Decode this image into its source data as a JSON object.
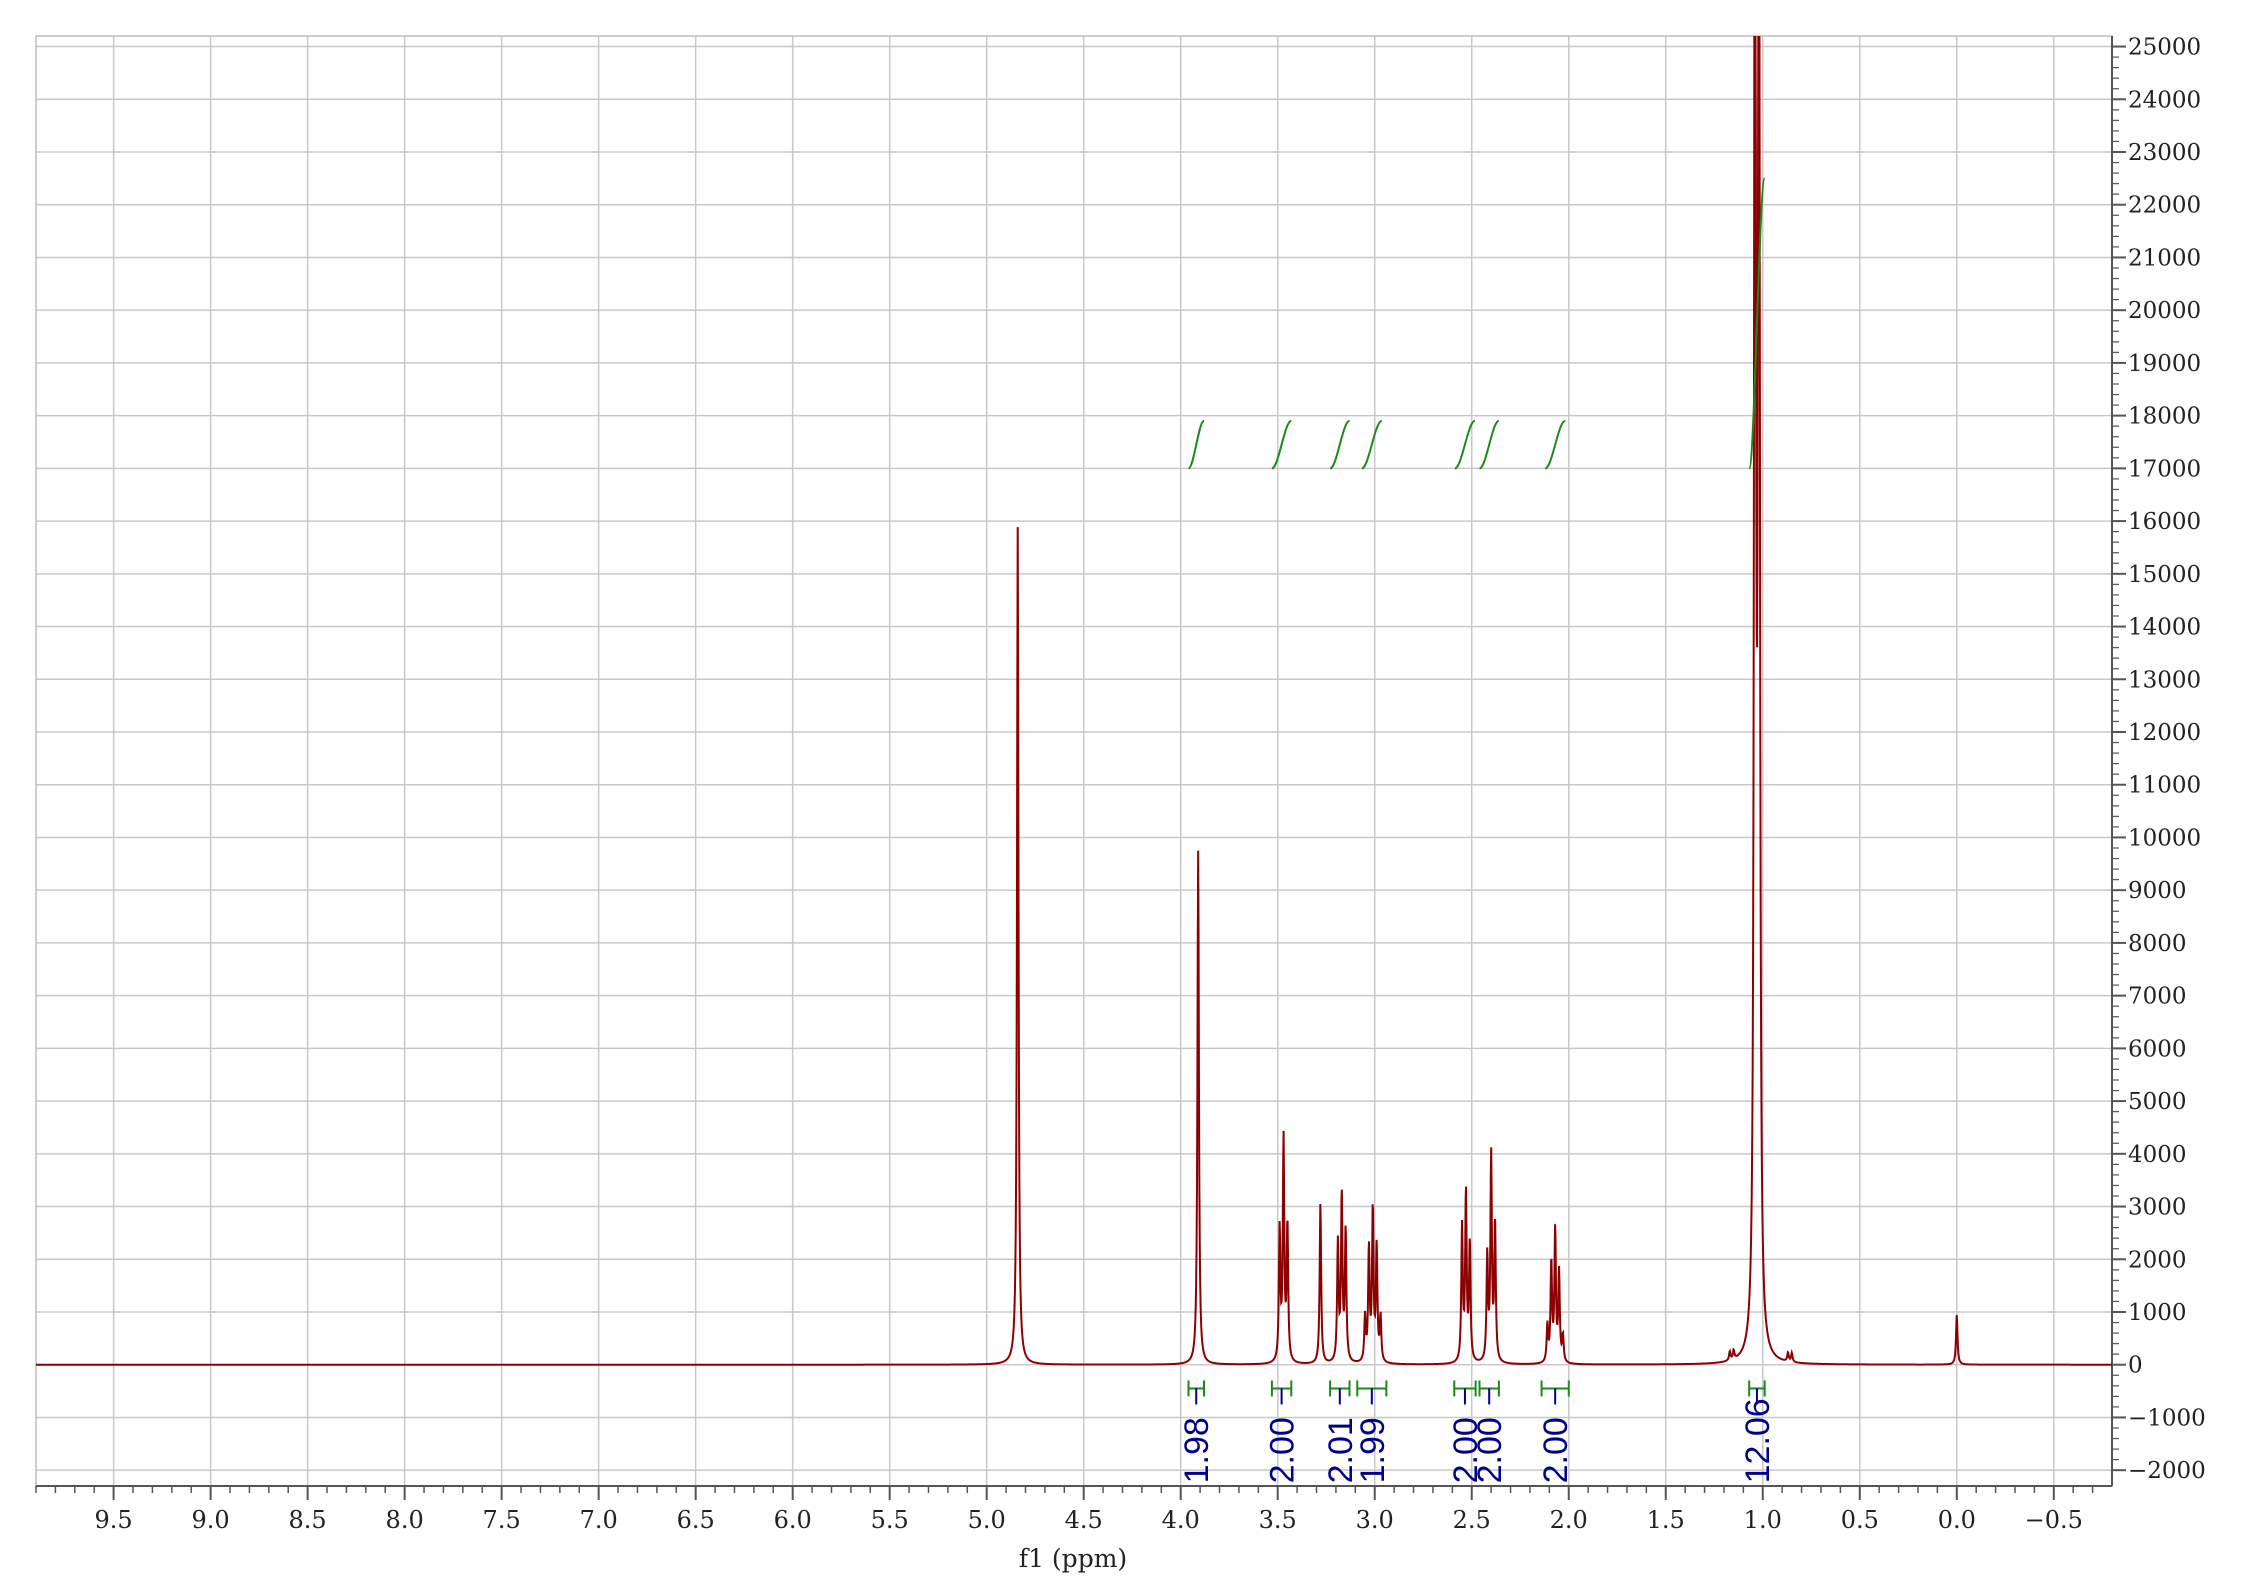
{
  "chart_data": {
    "type": "line",
    "title": "",
    "xlabel": "f1 (ppm)",
    "ylabel": "",
    "x_reversed": true,
    "xlim": [
      9.9,
      -0.8
    ],
    "ylim": [
      -2300,
      25200
    ],
    "x_ticks": [
      9.5,
      9.0,
      8.5,
      8.0,
      7.5,
      7.0,
      6.5,
      6.0,
      5.5,
      5.0,
      4.5,
      4.0,
      3.5,
      3.0,
      2.5,
      2.0,
      1.5,
      1.0,
      0.5,
      0.0,
      -0.5
    ],
    "x_tick_labels": [
      "9.5",
      "9.0",
      "8.5",
      "8.0",
      "7.5",
      "7.0",
      "6.5",
      "6.0",
      "5.5",
      "5.0",
      "4.5",
      "4.0",
      "3.5",
      "3.0",
      "2.5",
      "2.0",
      "1.5",
      "1.0",
      "0.5",
      "0.0",
      "−0.5"
    ],
    "y_ticks": [
      25000,
      24000,
      23000,
      22000,
      21000,
      20000,
      19000,
      18000,
      17000,
      16000,
      15000,
      14000,
      13000,
      12000,
      11000,
      10000,
      9000,
      8000,
      7000,
      6000,
      5000,
      4000,
      3000,
      2000,
      1000,
      0,
      -1000,
      -2000
    ],
    "y_tick_labels": [
      "25000",
      "24000",
      "23000",
      "22000",
      "21000",
      "20000",
      "19000",
      "18000",
      "17000",
      "16000",
      "15000",
      "14000",
      "13000",
      "12000",
      "11000",
      "10000",
      "9000",
      "8000",
      "7000",
      "6000",
      "5000",
      "4000",
      "3000",
      "2000",
      "1000",
      "0",
      "−1000",
      "−2000"
    ],
    "grid": true,
    "y_axis_position": "right",
    "series": [
      {
        "peaks": [
          {
            "ppm": 4.84,
            "height": 15900
          },
          {
            "ppm": 3.91,
            "height": 9750
          },
          {
            "ppm": 3.49,
            "height": 2500
          },
          {
            "ppm": 3.47,
            "height": 4200
          },
          {
            "ppm": 3.45,
            "height": 2600
          },
          {
            "ppm": 3.28,
            "height": 3050
          },
          {
            "ppm": 3.19,
            "height": 2250
          },
          {
            "ppm": 3.17,
            "height": 3150
          },
          {
            "ppm": 3.15,
            "height": 2500
          },
          {
            "ppm": 3.05,
            "height": 850
          },
          {
            "ppm": 3.03,
            "height": 2150
          },
          {
            "ppm": 3.01,
            "height": 2900
          },
          {
            "ppm": 2.99,
            "height": 2150
          },
          {
            "ppm": 2.97,
            "height": 850
          },
          {
            "ppm": 2.55,
            "height": 2550
          },
          {
            "ppm": 2.53,
            "height": 3200
          },
          {
            "ppm": 2.51,
            "height": 2250
          },
          {
            "ppm": 2.42,
            "height": 2000
          },
          {
            "ppm": 2.4,
            "height": 3900
          },
          {
            "ppm": 2.38,
            "height": 2650
          },
          {
            "ppm": 2.11,
            "height": 700
          },
          {
            "ppm": 2.09,
            "height": 1900
          },
          {
            "ppm": 2.07,
            "height": 2500
          },
          {
            "ppm": 2.05,
            "height": 1700
          },
          {
            "ppm": 2.03,
            "height": 500
          },
          {
            "ppm": 1.04,
            "height": 40000
          },
          {
            "ppm": 1.02,
            "height": 40000
          },
          {
            "ppm": 1.17,
            "height": 170
          },
          {
            "ppm": 1.15,
            "height": 170
          },
          {
            "ppm": 0.87,
            "height": 170
          },
          {
            "ppm": 0.85,
            "height": 170
          },
          {
            "ppm": 0.0,
            "height": 950
          }
        ]
      }
    ],
    "integrals": [
      {
        "from": 3.96,
        "to": 3.88,
        "value": "1.98"
      },
      {
        "from": 3.53,
        "to": 3.43,
        "value": "2.00"
      },
      {
        "from": 3.23,
        "to": 3.13,
        "value": "2.01"
      },
      {
        "from": 3.09,
        "to": 2.94,
        "value": "1.99"
      },
      {
        "from": 2.59,
        "to": 2.48,
        "value": "2.00"
      },
      {
        "from": 2.46,
        "to": 2.36,
        "value": "2.00"
      },
      {
        "from": 2.14,
        "to": 2.0,
        "value": "2.00"
      },
      {
        "from": 1.07,
        "to": 0.99,
        "value": "12.06"
      }
    ],
    "colors": {
      "spectrum": "#8b0000",
      "integral_curve": "#1a8a1a",
      "integral_label": "#00008b",
      "grid": "#c8c8c8",
      "axis": "#555555"
    }
  }
}
